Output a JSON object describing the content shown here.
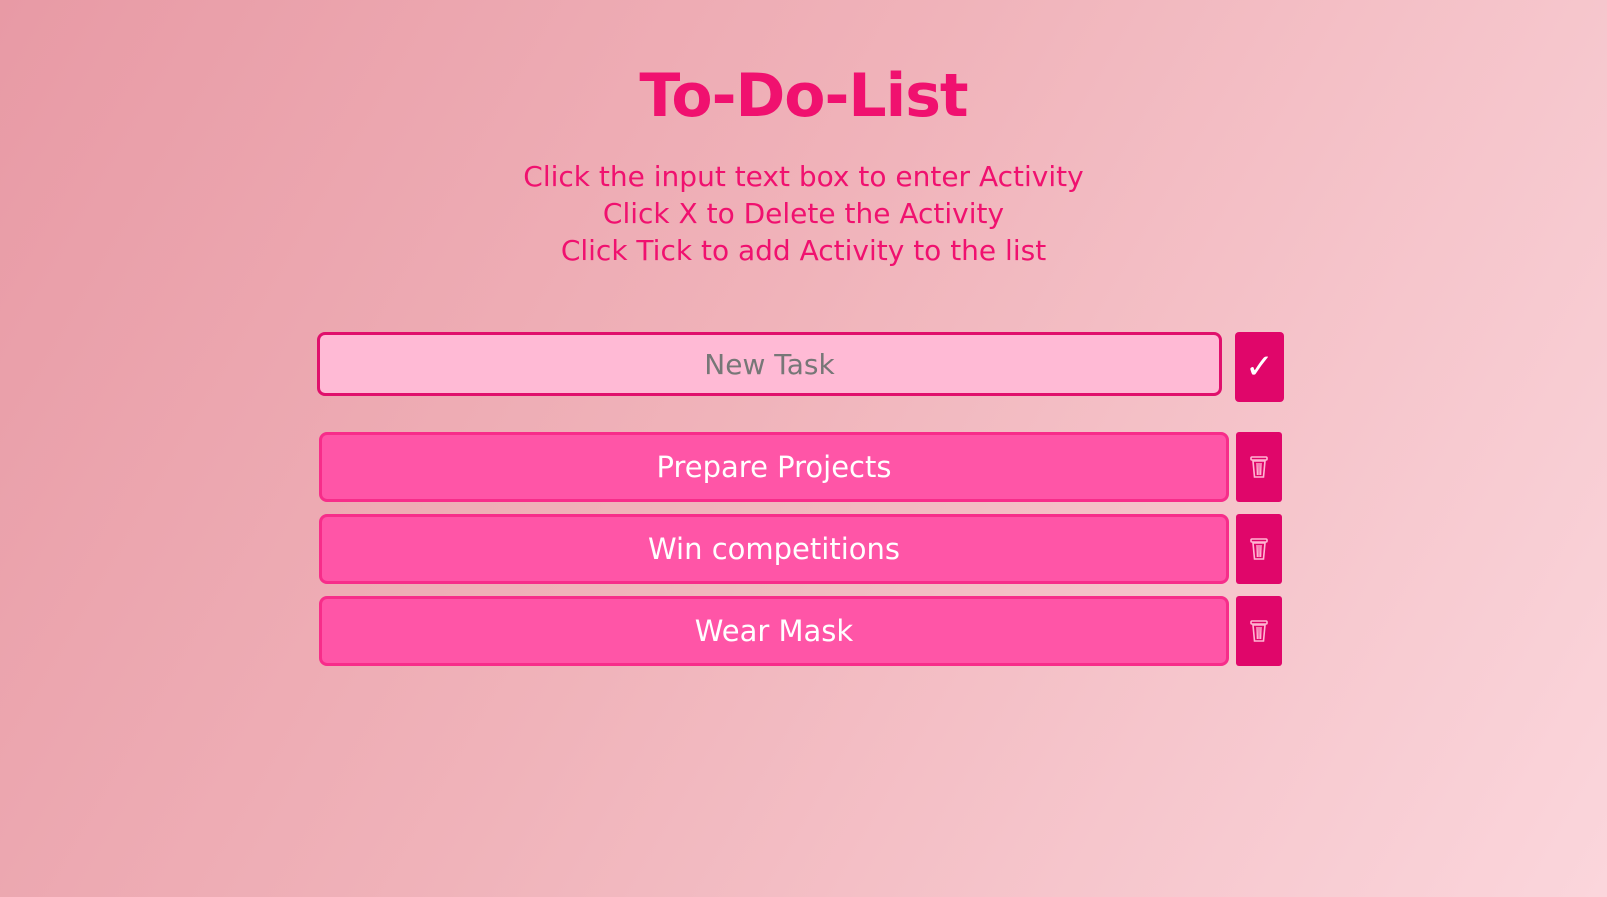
{
  "app": {
    "title": "To-Do-List"
  },
  "instructions": [
    "Click the input text box to enter Activity",
    "Click X to Delete the Activity",
    "Click Tick to add Activity to the list"
  ],
  "input": {
    "value": "",
    "placeholder": "New Task",
    "add_icon": "check-icon",
    "add_label": "✓"
  },
  "tasks": [
    {
      "label": "Prepare Projects",
      "delete_icon": "trash-icon"
    },
    {
      "label": "Win competitions",
      "delete_icon": "trash-icon"
    },
    {
      "label": "Wear Mask",
      "delete_icon": "trash-icon"
    }
  ],
  "colors": {
    "accent": "#f0116f",
    "button": "#e0066a",
    "item_bg": "#ff55a7",
    "input_bg": "#ffbad5"
  }
}
